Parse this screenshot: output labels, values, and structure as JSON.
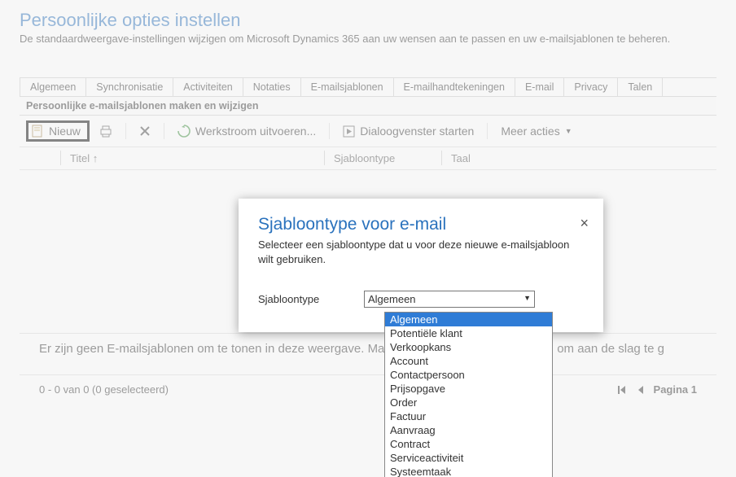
{
  "header": {
    "title": "Persoonlijke opties instellen",
    "description": "De standaardweergave-instellingen wijzigen om Microsoft Dynamics 365 aan uw wensen aan te passen en uw e-mailsjablonen te beheren."
  },
  "tabs": [
    "Algemeen",
    "Synchronisatie",
    "Activiteiten",
    "Notaties",
    "E-mailsjablonen",
    "E-mailhandtekeningen",
    "E-mail",
    "Privacy",
    "Talen"
  ],
  "section_title": "Persoonlijke e-mailsjablonen maken en wijzigen",
  "toolbar": {
    "new_label": "Nieuw",
    "run_workflow_label": "Werkstroom uitvoeren...",
    "start_dialog_label": "Dialoogvenster starten",
    "more_actions_label": "Meer acties"
  },
  "grid": {
    "col_title": "Titel ↑",
    "col_type": "Sjabloontype",
    "col_lang": "Taal",
    "empty_message": "Er zijn geen E-mailsjablonen om te tonen in deze weergave. Maak een nieuwe E-mailsjablonen om aan de slag te g"
  },
  "pager": {
    "status": "0 - 0  van 0 (0 geselecteerd)",
    "page_label": "Pagina 1"
  },
  "dialog": {
    "title": "Sjabloontype voor e-mail",
    "description": "Selecteer een sjabloontype dat u voor deze nieuwe e-mailsjabloon wilt gebruiken.",
    "field_label": "Sjabloontype",
    "selected_value": "Algemeen",
    "options": [
      "Algemeen",
      "Potentiële klant",
      "Verkoopkans",
      "Account",
      "Contactpersoon",
      "Prijsopgave",
      "Order",
      "Factuur",
      "Aanvraag",
      "Contract",
      "Serviceactiviteit",
      "Systeemtaak"
    ]
  }
}
